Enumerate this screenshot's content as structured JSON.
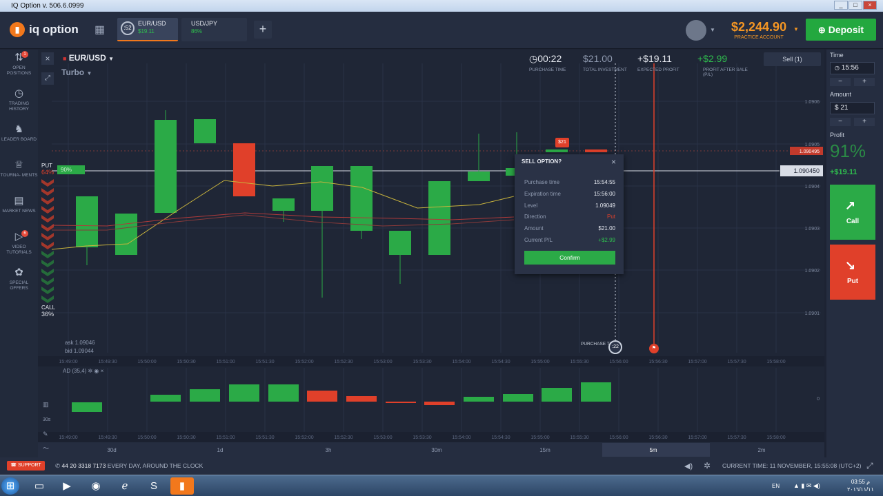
{
  "window": {
    "title": "IQ Option v. 506.6.0999"
  },
  "topbar": {
    "logo": "iq option",
    "assets": [
      {
        "name": "EUR/USD",
        "profit": "$19.11",
        "timer": ":52"
      },
      {
        "name": "USD/JPY",
        "profit": "86%"
      }
    ],
    "add": "+",
    "balance": "$2,244.90",
    "account_type": "PRACTICE ACCOUNT",
    "deposit": "Deposit"
  },
  "sidebar": {
    "items": [
      {
        "label": "OPEN POSITIONS",
        "badge": "1"
      },
      {
        "label": "TRADING HISTORY"
      },
      {
        "label": "LEADER BOARD"
      },
      {
        "label": "TOURNA- MENTS"
      },
      {
        "label": "MARKET NEWS"
      },
      {
        "label": "VIDEO TUTORIALS",
        "badge": "6"
      },
      {
        "label": "SPECIAL OFFERS"
      }
    ]
  },
  "chart_header": {
    "asset": "EUR/USD",
    "mode": "Turbo",
    "purchase_time": "00:22",
    "purchase_time_label": "PURCHASE TIME",
    "total_investment": "$21.00",
    "total_investment_label": "TOTAL INVESTMENT",
    "expected_profit": "+$19.11",
    "expected_profit_label": "EXPECTED PROFIT",
    "profit_after_sale": "+$2.99",
    "profit_after_sale_label": "PROFIT AFTER SALE (P/L)",
    "sell_button": "Sell (1)"
  },
  "sentiment": {
    "put_label": "PUT",
    "put_pct": "64%",
    "call_label": "CALL",
    "call_pct": "36%",
    "badge": "90%"
  },
  "quotes": {
    "ask": "ask 1.09046",
    "bid": "bid 1.09044"
  },
  "price_axis": [
    "1.0906",
    "1.0905",
    "1.090495",
    "1.090450",
    "1.0904",
    "1.0903",
    "1.0902",
    "1.0901",
    "0"
  ],
  "time_axis": [
    "15:49:00",
    "15:49:30",
    "15:50:00",
    "15:50:30",
    "15:51:00",
    "15:51:30",
    "15:52:00",
    "15:52:30",
    "15:53:00",
    "15:53:30",
    "15:54:00",
    "15:54:30",
    "15:55:00",
    "15:55:30",
    "15:56:00",
    "15:56:30",
    "15:57:00",
    "15:57:30",
    "15:58:00"
  ],
  "chart_markers": {
    "investment_tag": "$21",
    "purchase_time_label": "PURCHASE TIME",
    "purchase_countdown": ":22"
  },
  "indicator": {
    "label": "AD (35,4)",
    "small": "30s"
  },
  "periods": [
    "30d",
    "1d",
    "3h",
    "30m",
    "15m",
    "5m",
    "2m"
  ],
  "popup": {
    "title": "SELL OPTION?",
    "rows": [
      {
        "label": "Purchase time",
        "value": "15:54:55"
      },
      {
        "label": "Expiration time",
        "value": "15:56:00"
      },
      {
        "label": "Level",
        "value": "1.09049"
      },
      {
        "label": "Direction",
        "value": "Put"
      },
      {
        "label": "Amount",
        "value": "$21.00"
      },
      {
        "label": "Current P/L",
        "value": "+$2.99"
      }
    ],
    "confirm": "Confirm"
  },
  "right_panel": {
    "time_label": "Time",
    "time_value": "15:56",
    "amount_label": "Amount",
    "amount_value": "$ 21",
    "profit_label": "Profit",
    "profit_pct": "91%",
    "profit_value": "+$19.11",
    "call": "Call",
    "put": "Put",
    "minus": "−",
    "plus": "+"
  },
  "bottom": {
    "support": "SUPPORT",
    "phone": "44 20 3318 7173",
    "slogan": "EVERY DAY, AROUND THE CLOCK",
    "current_time": "CURRENT TIME: 11 NOVEMBER, 15:55:08 (UTC+2)"
  },
  "taskbar": {
    "lang": "EN",
    "clock_time": "03:55 م",
    "clock_date": "٢٠١٦/١١/١١"
  },
  "colors": {
    "green": "#2baa47",
    "red": "#e0402a",
    "orange": "#f59623",
    "bg": "#1f2636"
  }
}
